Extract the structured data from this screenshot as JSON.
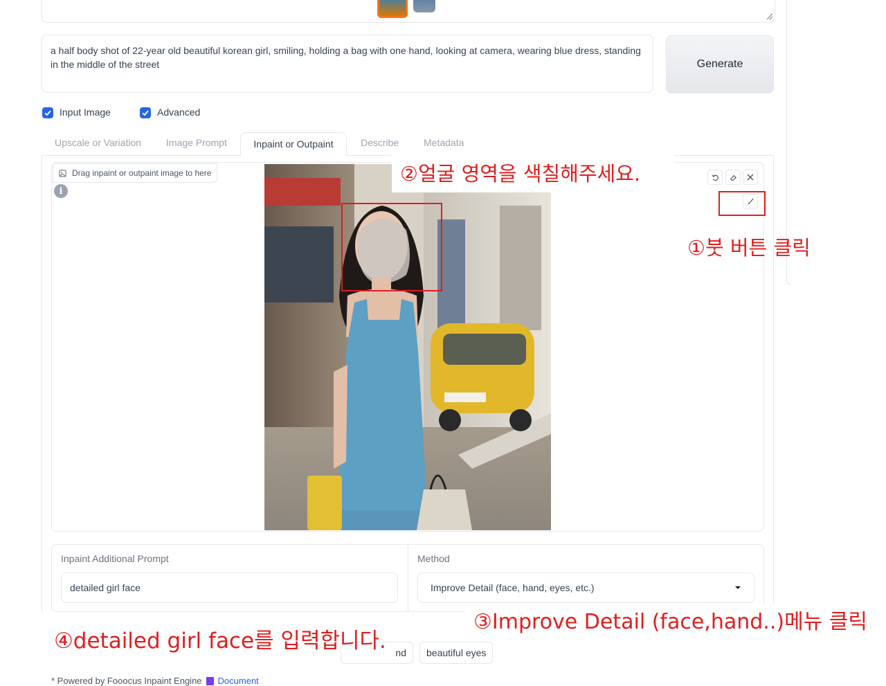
{
  "prompt": {
    "text": "a half body shot of 22-year old beautiful korean girl, smiling, holding a bag with one hand, looking at camera, wearing blue dress, standing in the middle of the street"
  },
  "generate_button": {
    "label": "Generate"
  },
  "options": [
    {
      "label": "Input Image",
      "checked": true
    },
    {
      "label": "Advanced",
      "checked": true
    }
  ],
  "tabs": [
    {
      "label": "Upscale or Variation",
      "active": false
    },
    {
      "label": "Image Prompt",
      "active": false
    },
    {
      "label": "Inpaint or Outpaint",
      "active": true
    },
    {
      "label": "Describe",
      "active": false
    },
    {
      "label": "Metadata",
      "active": false
    }
  ],
  "canvas": {
    "drop_label": "Drag inpaint or outpaint image to here",
    "info_icon": "i"
  },
  "inpaint_form": {
    "additional_prompt_label": "Inpaint Additional Prompt",
    "additional_prompt_value": "detailed girl face",
    "method_label": "Method",
    "method_value": "Improve Detail (face, hand, eyes, etc.)"
  },
  "chips": [
    "nd",
    "beautiful eyes"
  ],
  "footer": {
    "text": "* Powered by Fooocus Inpaint Engine",
    "link": "Document"
  },
  "annotations": {
    "step1": "①붓 버튼 클릭",
    "step2": "②얼굴 영역을 색칠해주세요.",
    "step3": "③Improve Detail (face,hand..)메뉴 클릭",
    "step4": "④detailed girl face를 입력합니다."
  },
  "colors": {
    "accent_checkbox": "#2563eb",
    "annotation_red": "#e11d1d",
    "selected_thumb_border": "#f97316"
  }
}
